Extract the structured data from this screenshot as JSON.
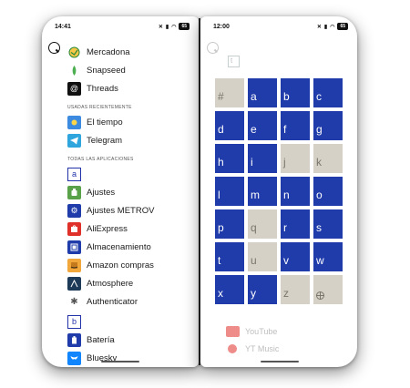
{
  "left_screen": {
    "status": {
      "time": "14:41",
      "battery": "65"
    },
    "pinned": [
      {
        "label": "Mercadona",
        "icon": "mercadona-icon",
        "color": "#ffffff"
      },
      {
        "label": "Snapseed",
        "icon": "snapseed-icon",
        "color": "#ffffff"
      },
      {
        "label": "Threads",
        "icon": "threads-icon",
        "color": "#111111"
      }
    ],
    "recent_header": "USADAS RECIENTEMENTE",
    "recent": [
      {
        "label": "El tiempo",
        "icon": "weather-icon",
        "color": "#3d8be0"
      },
      {
        "label": "Telegram",
        "icon": "telegram-icon",
        "color": "#2ea6dd"
      }
    ],
    "all_header": "TODAS LAS APLICACIONES",
    "letter_a": "a",
    "apps_a": [
      {
        "label": "Ajustes",
        "icon": "android-settings-icon",
        "color": "#5aa24a"
      },
      {
        "label": "Ajustes METROV",
        "icon": "gear-icon",
        "color": "#1f3caa"
      },
      {
        "label": "AliExpress",
        "icon": "aliexpress-icon",
        "color": "#e0302a"
      },
      {
        "label": "Almacenamiento",
        "icon": "storage-icon",
        "color": "#1f3caa"
      },
      {
        "label": "Amazon compras",
        "icon": "amazon-icon",
        "color": "#f2a73b"
      },
      {
        "label": "Atmosphere",
        "icon": "atmosphere-icon",
        "color": "#1d3a58"
      },
      {
        "label": "Authenticator",
        "icon": "authenticator-icon",
        "color": "#ffffff"
      }
    ],
    "letter_b": "b",
    "apps_b": [
      {
        "label": "Batería",
        "icon": "battery-icon",
        "color": "#1f3caa"
      },
      {
        "label": "Bluesky",
        "icon": "bluesky-icon",
        "color": "#1185fe"
      }
    ]
  },
  "right_screen": {
    "status": {
      "time": "12:00",
      "battery": "65"
    },
    "letters": [
      {
        "letter": "#",
        "active": false
      },
      {
        "letter": "a",
        "active": true
      },
      {
        "letter": "b",
        "active": true
      },
      {
        "letter": "c",
        "active": true
      },
      {
        "letter": "d",
        "active": true
      },
      {
        "letter": "e",
        "active": true
      },
      {
        "letter": "f",
        "active": true
      },
      {
        "letter": "g",
        "active": true
      },
      {
        "letter": "h",
        "active": true
      },
      {
        "letter": "i",
        "active": true
      },
      {
        "letter": "j",
        "active": false
      },
      {
        "letter": "k",
        "active": false
      },
      {
        "letter": "l",
        "active": true
      },
      {
        "letter": "m",
        "active": true
      },
      {
        "letter": "n",
        "active": true
      },
      {
        "letter": "o",
        "active": true
      },
      {
        "letter": "p",
        "active": true
      },
      {
        "letter": "q",
        "active": false
      },
      {
        "letter": "r",
        "active": true
      },
      {
        "letter": "s",
        "active": true
      },
      {
        "letter": "t",
        "active": true
      },
      {
        "letter": "u",
        "active": false
      },
      {
        "letter": "v",
        "active": true
      },
      {
        "letter": "w",
        "active": true
      },
      {
        "letter": "x",
        "active": true
      },
      {
        "letter": "y",
        "active": true
      },
      {
        "letter": "z",
        "active": false
      },
      {
        "letter": "",
        "active": false,
        "icon": "globe-icon"
      }
    ],
    "background_apps": [
      {
        "label": "YouTube",
        "color": "#e0302a"
      },
      {
        "label": "YT Music",
        "color": "#e0302a"
      }
    ],
    "background_letter": "t"
  }
}
